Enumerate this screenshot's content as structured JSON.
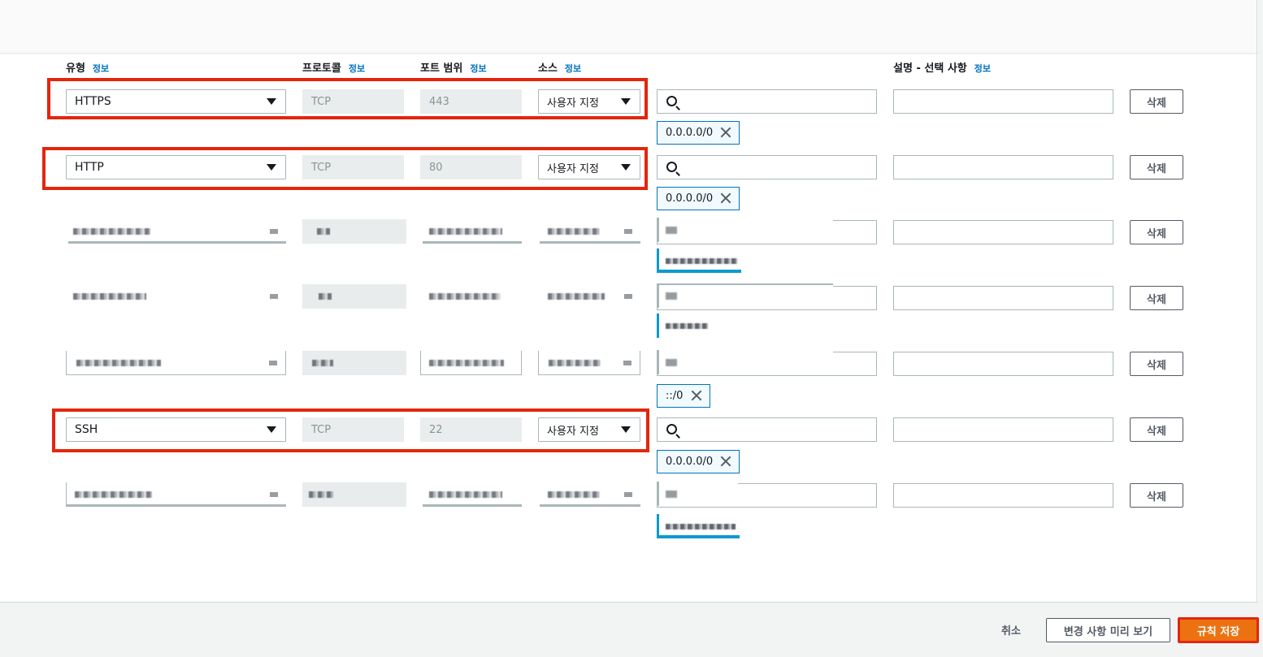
{
  "headers": {
    "type": "유형",
    "protocol": "프로토콜",
    "port_range": "포트 범위",
    "source": "소스",
    "description": "설명 - 선택 사항",
    "info": "정보"
  },
  "rows": [
    {
      "type": "HTTPS",
      "protocol": "TCP",
      "port": "443",
      "source_mode": "사용자 지정",
      "cidr": "0.0.0.0/0",
      "delete": "삭제"
    },
    {
      "type": "HTTP",
      "protocol": "TCP",
      "port": "80",
      "source_mode": "사용자 지정",
      "cidr": "0.0.0.0/0",
      "delete": "삭제"
    },
    {
      "delete": "삭제"
    },
    {
      "delete": "삭제"
    },
    {
      "cidr": "::/0",
      "delete": "삭제"
    },
    {
      "type": "SSH",
      "protocol": "TCP",
      "port": "22",
      "source_mode": "사용자 지정",
      "cidr": "0.0.0.0/0",
      "delete": "삭제"
    },
    {
      "delete": "삭제"
    }
  ],
  "footer": {
    "cancel": "취소",
    "preview": "변경 사항 미리 보기",
    "save": "규칙 저장"
  },
  "colors": {
    "primary_button": "#ec7211",
    "highlight_box": "#e3260d",
    "info_link": "#0073bb"
  }
}
